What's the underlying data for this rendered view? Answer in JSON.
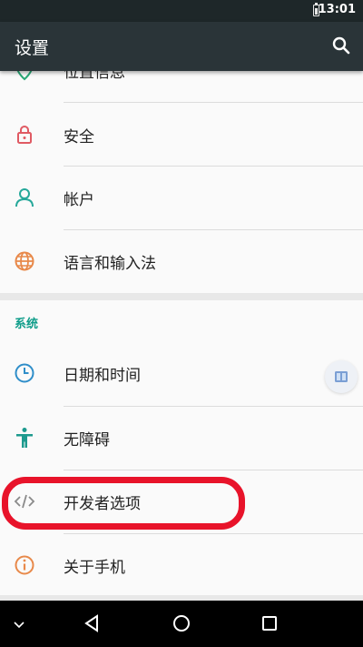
{
  "status_bar": {
    "time": "13:01"
  },
  "toolbar": {
    "title": "设置"
  },
  "partial_item": {
    "label": "位置信息"
  },
  "items_top": [
    {
      "label": "安全",
      "icon": "lock-icon"
    },
    {
      "label": "帐户",
      "icon": "account-icon"
    },
    {
      "label": "语言和输入法",
      "icon": "globe-icon"
    }
  ],
  "system_section": {
    "header": "系统",
    "items": [
      {
        "label": "日期和时间",
        "icon": "clock-icon"
      },
      {
        "label": "无障碍",
        "icon": "accessibility-icon"
      },
      {
        "label": "开发者选项",
        "icon": "code-icon"
      },
      {
        "label": "关于手机",
        "icon": "info-icon"
      }
    ]
  },
  "colors": {
    "toolbar": "#2a3438",
    "accent": "#0f9d8a",
    "highlight": "#e8132a"
  }
}
